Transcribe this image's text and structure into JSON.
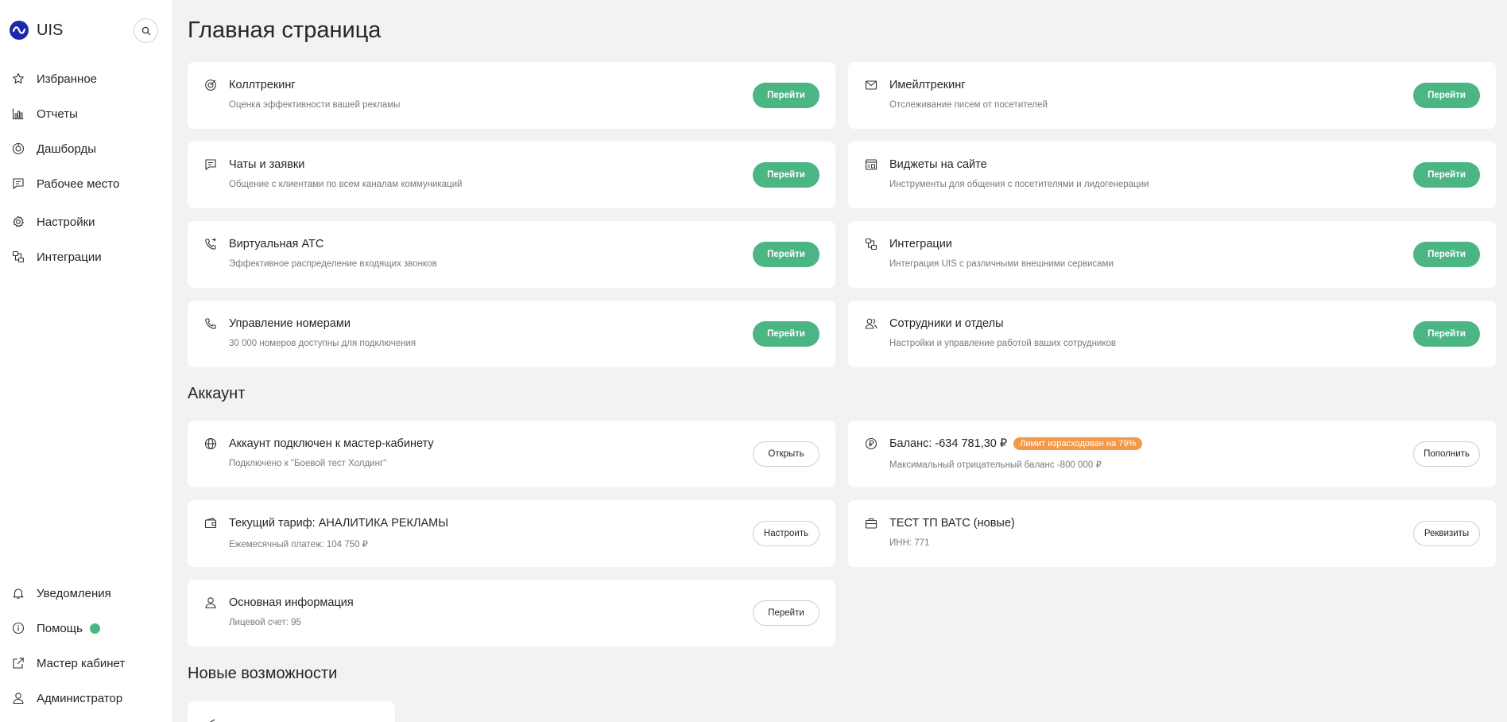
{
  "app": {
    "name": "UIS"
  },
  "sidebar": {
    "items": [
      {
        "label": "Избранное",
        "icon": "star-icon"
      },
      {
        "label": "Отчеты",
        "icon": "chart-icon"
      },
      {
        "label": "Дашборды",
        "icon": "dashboard-icon"
      },
      {
        "label": "Рабочее место",
        "icon": "workplace-icon"
      },
      {
        "label": "Настройки",
        "icon": "gear-icon"
      },
      {
        "label": "Интеграции",
        "icon": "integration-icon"
      }
    ],
    "bottom": [
      {
        "label": "Уведомления",
        "icon": "bell-icon"
      },
      {
        "label": "Помощь",
        "icon": "info-icon"
      },
      {
        "label": "Мастер кабинет",
        "icon": "external-link-icon"
      },
      {
        "label": "Администратор",
        "icon": "user-icon"
      }
    ]
  },
  "page": {
    "title": "Главная страница"
  },
  "products": [
    {
      "title": "Коллтрекинг",
      "subtitle": "Оценка эффективности вашей рекламы",
      "button": "Перейти",
      "icon": "target-icon"
    },
    {
      "title": "Имейлтрекинг",
      "subtitle": "Отслеживание писем от посетителей",
      "button": "Перейти",
      "icon": "mail-icon"
    },
    {
      "title": "Чаты и заявки",
      "subtitle": "Общение с клиентами по всем каналам коммуникаций",
      "button": "Перейти",
      "icon": "chat-icon"
    },
    {
      "title": "Виджеты на сайте",
      "subtitle": "Инструменты для общения с посетителями и лидогенерации",
      "button": "Перейти",
      "icon": "widget-icon"
    },
    {
      "title": "Виртуальная АТС",
      "subtitle": "Эффективное распределение входящих звонков",
      "button": "Перейти",
      "icon": "phone-transfer-icon"
    },
    {
      "title": "Интеграции",
      "subtitle": "Интеграция UIS с различными внешними сервисами",
      "button": "Перейти",
      "icon": "integration-icon"
    },
    {
      "title": "Управление номерами",
      "subtitle": "30 000 номеров доступны для подключения",
      "button": "Перейти",
      "icon": "phone-icon"
    },
    {
      "title": "Сотрудники и отделы",
      "subtitle": "Настройки и управление работой ваших сотрудников",
      "button": "Перейти",
      "icon": "users-icon"
    }
  ],
  "account": {
    "title": "Аккаунт",
    "cards": [
      {
        "title": "Аккаунт подключен к мастер-кабинету",
        "subtitle": "Подключено к \"Боевой тест Холдинг\"",
        "button": "Открыть",
        "icon": "globe-icon"
      },
      {
        "title": "Баланс: -634 781,30 ₽",
        "badge": "Лимит израсходован на 79%",
        "subtitle": "Максимальный отрицательный баланс -800 000 ₽",
        "button": "Пополнить",
        "icon": "ruble-icon"
      },
      {
        "title": "Текущий тариф: АНАЛИТИКА РЕКЛАМЫ",
        "subtitle": "Ежемесячный платеж: 104 750 ₽",
        "button": "Настроить",
        "icon": "wallet-icon"
      },
      {
        "title": "ТЕСТ ТП ВАТС (новые)",
        "subtitle": "ИНН: 771",
        "button": "Реквизиты",
        "icon": "briefcase-icon"
      },
      {
        "title": "Основная информация",
        "subtitle": "Лицевой счет: 95",
        "button": "Перейти",
        "icon": "user-icon"
      }
    ]
  },
  "new_features": {
    "title": "Новые возможности"
  },
  "colors": {
    "accent": "#4bb584",
    "badge": "#f2994a",
    "logo": "#1d29a8"
  }
}
